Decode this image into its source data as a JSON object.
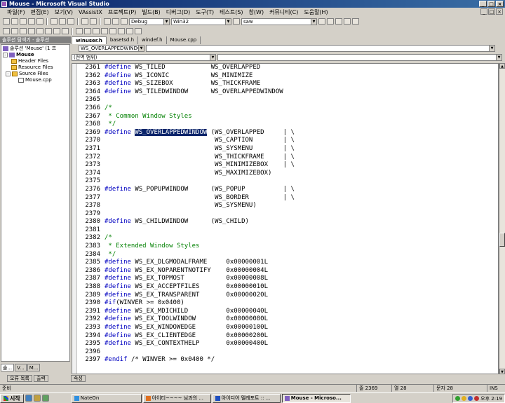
{
  "window": {
    "title": "Mouse - Microsoft Visual Studio",
    "min": "_",
    "max": "□",
    "close": "×"
  },
  "menu": [
    "파일(F)",
    "편집(E)",
    "보기(V)",
    "VAssistX",
    "프로젝트(P)",
    "빌드(B)",
    "디버그(D)",
    "도구(T)",
    "테스트(S)",
    "창(W)",
    "커뮤니티(C)",
    "도움말(H)"
  ],
  "toolbar1": {
    "config": "Debug",
    "platform": "Win32",
    "find": "saw"
  },
  "workspace": {
    "title": "솔루션 탐색기 - 솔루션",
    "solution": "솔루션 'Mouse' (1 프",
    "project": "Mouse",
    "folders": [
      "Header Files",
      "Resource Files",
      "Source Files"
    ],
    "file": "Mouse.cpp",
    "tab1": "솔...",
    "tab2": "V...",
    "tab3": "M..."
  },
  "editor": {
    "tabs": [
      "winuser.h",
      "basetsd.h",
      "windef.h",
      "Mouse.cpp"
    ],
    "scope_left": "WS_OVERLAPPEDWINDOW",
    "scope_right": "",
    "scope2": "(전역 범위)",
    "lines": [
      {
        "n": "2361",
        "pre": "#define ",
        "name": "WS_TILED",
        "rest": "            WS_OVERLAPPED"
      },
      {
        "n": "2362",
        "pre": "#define ",
        "name": "WS_ICONIC",
        "rest": "           WS_MINIMIZE"
      },
      {
        "n": "2363",
        "pre": "#define ",
        "name": "WS_SIZEBOX",
        "rest": "          WS_THICKFRAME"
      },
      {
        "n": "2364",
        "pre": "#define ",
        "name": "WS_TILEDWINDOW",
        "rest": "      WS_OVERLAPPEDWINDOW"
      },
      {
        "n": "2365",
        "pre": "",
        "name": "",
        "rest": ""
      },
      {
        "n": "2366",
        "cm": "/*"
      },
      {
        "n": "2367",
        "cm": " * Common Window Styles"
      },
      {
        "n": "2368",
        "cm": " */"
      },
      {
        "n": "2369",
        "pre": "#define ",
        "sel": "WS_OVERLAPPEDWINDOW",
        "rest": " (WS_OVERLAPPED     | \\"
      },
      {
        "n": "2370",
        "pre": "",
        "name": "",
        "rest": "                             WS_CAPTION        | \\"
      },
      {
        "n": "2371",
        "pre": "",
        "name": "",
        "rest": "                             WS_SYSMENU        | \\"
      },
      {
        "n": "2372",
        "pre": "",
        "name": "",
        "rest": "                             WS_THICKFRAME     | \\"
      },
      {
        "n": "2373",
        "pre": "",
        "name": "",
        "rest": "                             WS_MINIMIZEBOX    | \\"
      },
      {
        "n": "2374",
        "pre": "",
        "name": "",
        "rest": "                             WS_MAXIMIZEBOX)"
      },
      {
        "n": "2375",
        "pre": "",
        "name": "",
        "rest": ""
      },
      {
        "n": "2376",
        "pre": "#define ",
        "name": "WS_POPUPWINDOW",
        "rest": "      (WS_POPUP          | \\"
      },
      {
        "n": "2377",
        "pre": "",
        "name": "",
        "rest": "                             WS_BORDER         | \\"
      },
      {
        "n": "2378",
        "pre": "",
        "name": "",
        "rest": "                             WS_SYSMENU)"
      },
      {
        "n": "2379",
        "pre": "",
        "name": "",
        "rest": ""
      },
      {
        "n": "2380",
        "pre": "#define ",
        "name": "WS_CHILDWINDOW",
        "rest": "      (WS_CHILD)"
      },
      {
        "n": "2381",
        "pre": "",
        "name": "",
        "rest": ""
      },
      {
        "n": "2382",
        "cm": "/*"
      },
      {
        "n": "2383",
        "cm": " * Extended Window Styles"
      },
      {
        "n": "2384",
        "cm": " */"
      },
      {
        "n": "2385",
        "pre": "#define ",
        "name": "WS_EX_DLGMODALFRAME",
        "rest": "     0x00000001L"
      },
      {
        "n": "2386",
        "pre": "#define ",
        "name": "WS_EX_NOPARENTNOTIFY",
        "rest": "    0x00000004L"
      },
      {
        "n": "2387",
        "pre": "#define ",
        "name": "WS_EX_TOPMOST",
        "rest": "           0x00000008L"
      },
      {
        "n": "2388",
        "pre": "#define ",
        "name": "WS_EX_ACCEPTFILES",
        "rest": "       0x00000010L"
      },
      {
        "n": "2389",
        "pre": "#define ",
        "name": "WS_EX_TRANSPARENT",
        "rest": "       0x00000020L"
      },
      {
        "n": "2390",
        "pre": "#if",
        "name": "",
        "rest": "(WINVER >= 0x0400)"
      },
      {
        "n": "2391",
        "pre": "#define ",
        "name": "WS_EX_MDICHILD",
        "rest": "          0x00000040L"
      },
      {
        "n": "2392",
        "pre": "#define ",
        "name": "WS_EX_TOOLWINDOW",
        "rest": "        0x00000080L"
      },
      {
        "n": "2393",
        "pre": "#define ",
        "name": "WS_EX_WINDOWEDGE",
        "rest": "        0x00000100L"
      },
      {
        "n": "2394",
        "pre": "#define ",
        "name": "WS_EX_CLIENTEDGE",
        "rest": "        0x00000200L"
      },
      {
        "n": "2395",
        "pre": "#define ",
        "name": "WS_EX_CONTEXTHELP",
        "rest": "       0x00000400L"
      },
      {
        "n": "2396",
        "pre": "",
        "name": "",
        "rest": ""
      },
      {
        "n": "2397",
        "pre": "#endif ",
        "name": "",
        "rest": "/* WINVER >= 0x0400 */"
      }
    ]
  },
  "output_tabs": [
    "오류 목록",
    "출력",
    "속성"
  ],
  "status": {
    "ready": "준비",
    "line": "줄 2369",
    "col": "열 28",
    "ch": "문자 28",
    "mode": "INS"
  },
  "taskbar": {
    "start": "시작",
    "tasks": [
      "NateOn",
      "아이티~~~~ 님과의 ...",
      "아이디어 텔레포트 :: ...",
      "Mouse - Microso..."
    ],
    "clock": "오후 2:19"
  },
  "colors": {
    "titlebar": "#0a246a",
    "selection": "#0a246a",
    "keyword": "#0000c0",
    "comment": "#008000"
  }
}
